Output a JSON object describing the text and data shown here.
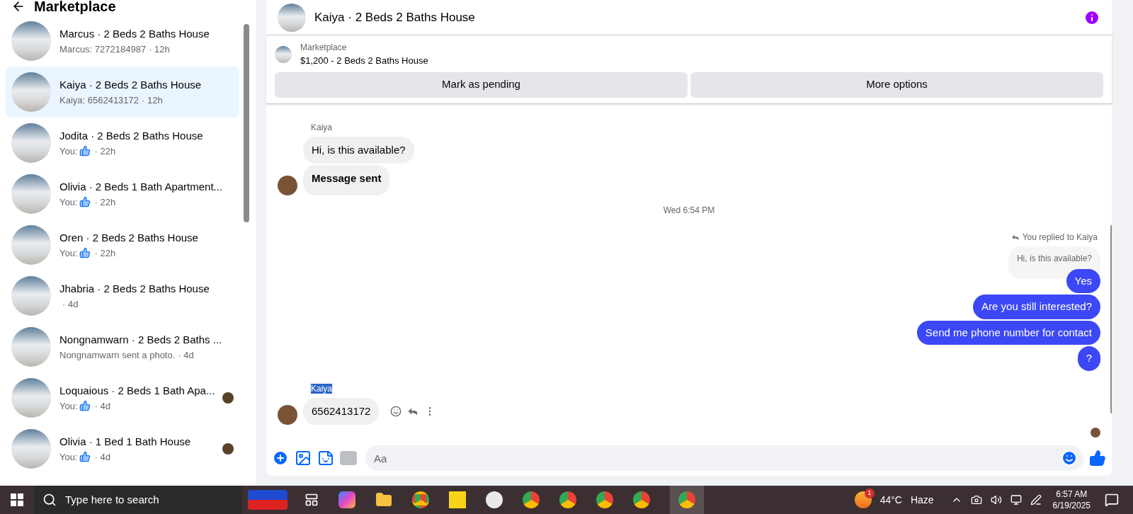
{
  "sidebar": {
    "title": "Marketplace",
    "conversations": [
      {
        "title": "Marcus · 2 Beds 2 Baths House",
        "kind": "text",
        "preview": "Marcus: 7272184987",
        "time": "· 12h",
        "selected": false,
        "seen": false
      },
      {
        "title": "Kaiya · 2 Beds 2 Baths House",
        "kind": "text",
        "preview": "Kaiya: 6562413172",
        "time": "· 12h",
        "selected": true,
        "seen": false
      },
      {
        "title": "Jodita · 2 Beds 2 Baths House",
        "kind": "like",
        "preview": "You:",
        "time": "· 22h",
        "selected": false,
        "seen": false
      },
      {
        "title": "Olivia · 2 Beds 1 Bath Apartment...",
        "kind": "like",
        "preview": "You:",
        "time": "· 22h",
        "selected": false,
        "seen": false
      },
      {
        "title": "Oren · 2 Beds 2 Baths House",
        "kind": "like",
        "preview": "You:",
        "time": "· 22h",
        "selected": false,
        "seen": false
      },
      {
        "title": "Jhabria · 2 Beds 2 Baths House",
        "kind": "text",
        "time": "· 4d",
        "selected": false,
        "seen": false
      },
      {
        "title": "Nongnamwarn · 2 Beds 2 Baths ...",
        "kind": "text",
        "preview": "Nongnamwarn sent a photo.",
        "time": "· 4d",
        "selected": false,
        "seen": false
      },
      {
        "title": "Loquaious · 2 Beds 1 Bath Apa...",
        "kind": "like",
        "preview": "You:",
        "time": "· 4d",
        "selected": false,
        "seen": true
      },
      {
        "title": "Olivia · 1 Bed 1 Bath House",
        "kind": "like",
        "preview": "You:",
        "time": "· 4d",
        "selected": false,
        "seen": true
      }
    ]
  },
  "chat": {
    "title": "Kaiya · 2 Beds 2 Baths House",
    "listing": {
      "label": "Marketplace",
      "name": "$1,200 - 2 Beds 2 Baths House"
    },
    "buttons": [
      "Mark as pending",
      "More options"
    ],
    "thread": [
      {
        "kind": "sender",
        "text": "Kaiya",
        "highlighted": false
      },
      {
        "kind": "incoming",
        "text": "Hi, is this available?",
        "avatar": false,
        "bold": false
      },
      {
        "kind": "incoming",
        "text": "Message sent",
        "avatar": true,
        "bold": true
      },
      {
        "kind": "timestamp",
        "text": "Wed 6:54 PM"
      },
      {
        "kind": "reply_note",
        "text": "You replied to Kaiya"
      },
      {
        "kind": "quoted",
        "text": "Hi, is this available?"
      },
      {
        "kind": "outgoing",
        "text": "Yes"
      },
      {
        "kind": "outgoing",
        "text": "Are you still interested?"
      },
      {
        "kind": "outgoing",
        "text": "Send me phone number for contact"
      },
      {
        "kind": "outgoing",
        "text": "?"
      },
      {
        "kind": "sender",
        "text": "Kaiya",
        "highlighted": true
      },
      {
        "kind": "incoming_actions",
        "text": "6562413172",
        "avatar": true,
        "bold": false
      }
    ],
    "composer": {
      "placeholder": "Aa"
    }
  },
  "taskbar": {
    "search_placeholder": "Type here to search",
    "temperature": "44°C",
    "weather": "Haze",
    "weather_badge": "1",
    "time": "6:57 AM",
    "date": "6/19/2025"
  }
}
